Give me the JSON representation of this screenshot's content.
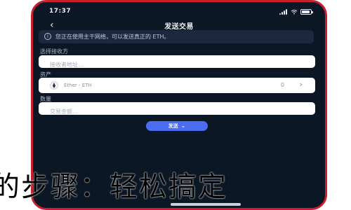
{
  "status_bar": {
    "time": "17:37"
  },
  "header": {
    "title": "发送交易"
  },
  "notice": {
    "text": "您正在使用主干网络，可以发送真正的 ETH。"
  },
  "form": {
    "recipient_label": "选择接收方",
    "recipient_placeholder": "接收者地址...",
    "asset_label": "资产",
    "asset_name": "Ether - ETH",
    "asset_balance": "0",
    "amount_label": "数量",
    "amount_placeholder": "交易金额..."
  },
  "actions": {
    "send_label": "发送"
  },
  "overlay": {
    "text": "的步骤：轻松搞定"
  },
  "icons": {
    "back": "chevron-left-icon",
    "info": "info-icon",
    "asset": "ethereum-icon",
    "asset_chevron": "chevron-right-icon",
    "send_chevron": "chevron-down-icon",
    "signal": "signal-icon",
    "wifi": "wifi-icon",
    "battery": "battery-icon"
  },
  "colors": {
    "background": "#0c1726",
    "frame_accent": "#c91f2f",
    "notice_bg": "#1b2840",
    "primary_button": "#4b6df1",
    "field_bg": "#ffffff"
  }
}
